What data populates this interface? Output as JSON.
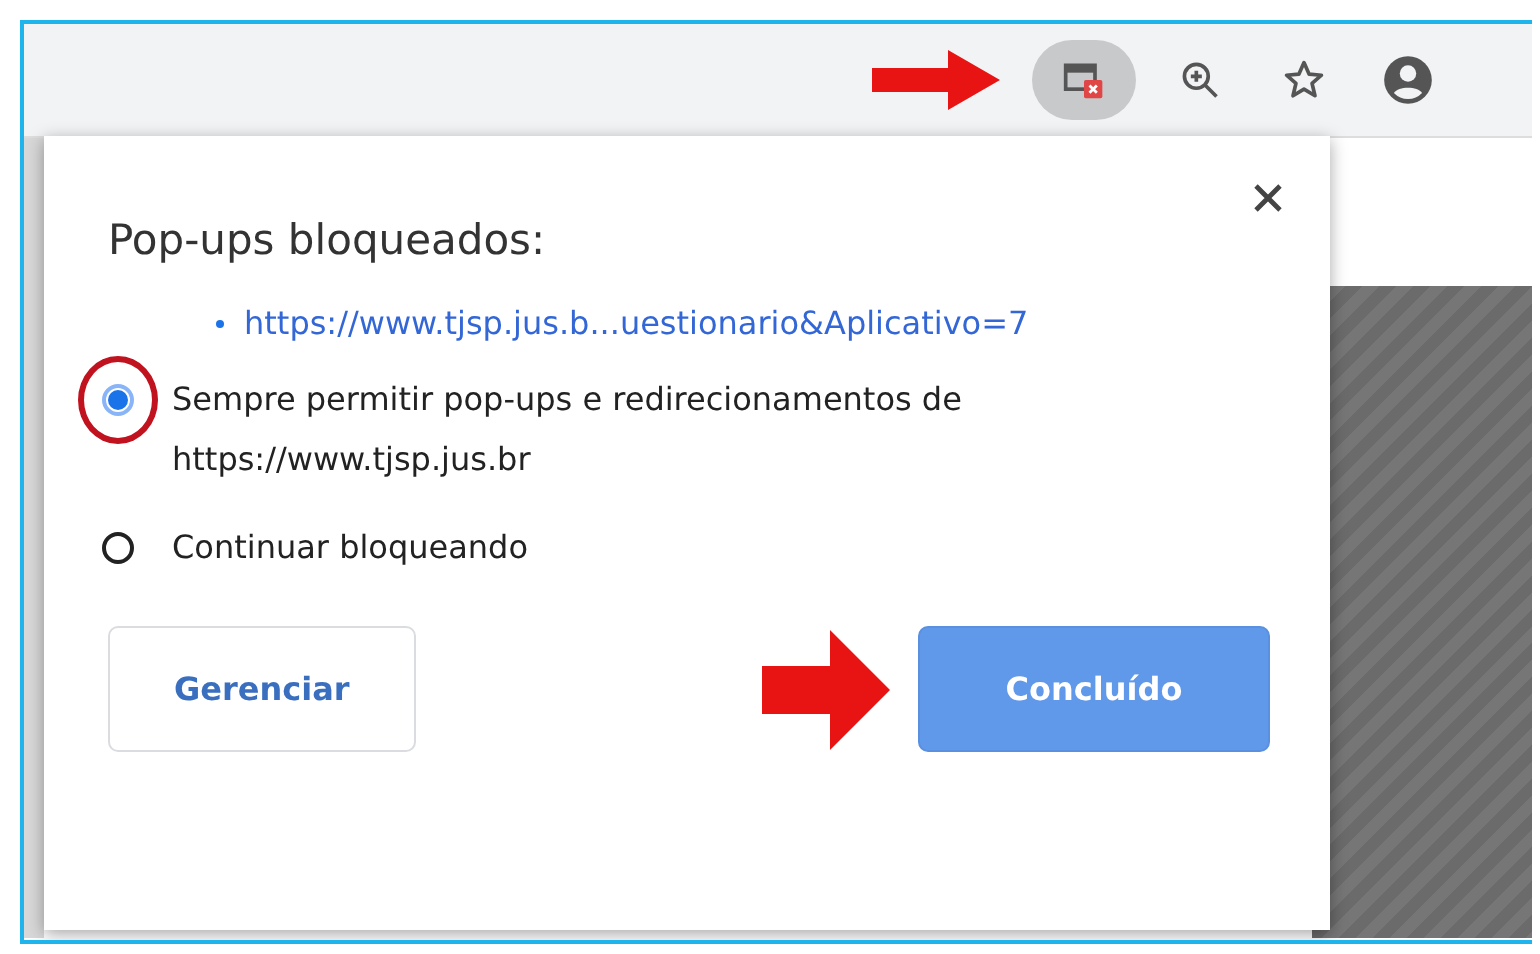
{
  "popup": {
    "title": "Pop-ups bloqueados:",
    "blocked_links": [
      "https://www.tjsp.jus.b...uestionario&Aplicativo=7"
    ],
    "options": [
      {
        "label": "Sempre permitir pop-ups e redirecionamentos de https://www.tjsp.jus.br",
        "selected": true
      },
      {
        "label": "Continuar bloqueando",
        "selected": false
      }
    ],
    "buttons": [
      {
        "label": "Gerenciar",
        "kind": "secondary"
      },
      {
        "label": "Concluído",
        "kind": "primary"
      }
    ]
  }
}
